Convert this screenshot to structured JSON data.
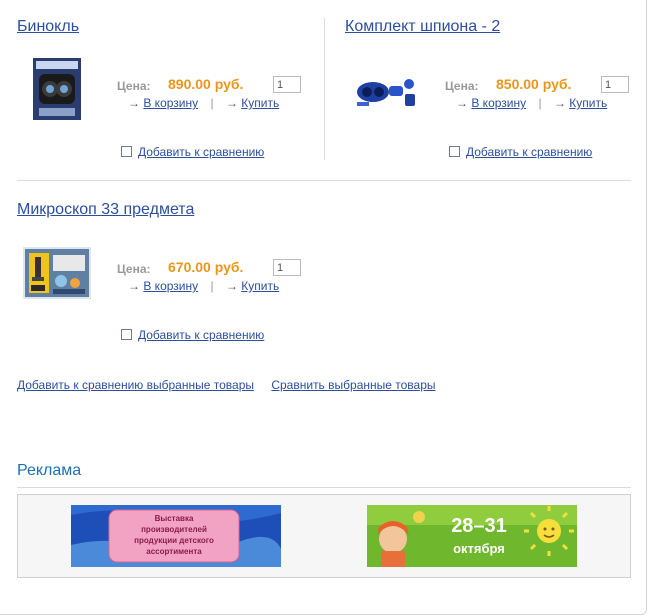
{
  "products": [
    {
      "title": "Бинокль",
      "price_label": "Цена:",
      "price": "890.00 руб.",
      "qty": "1",
      "cart": "В корзину",
      "buy": "Купить",
      "compare": "Добавить к сравнению"
    },
    {
      "title": "Комплект шпиона - 2",
      "price_label": "Цена:",
      "price": "850.00 руб.",
      "qty": "1",
      "cart": "В корзину",
      "buy": "Купить",
      "compare": "Добавить к сравнению"
    },
    {
      "title": "Микроскоп 33 предмета",
      "price_label": "Цена:",
      "price": "670.00 руб.",
      "qty": "1",
      "cart": "В корзину",
      "buy": "Купить",
      "compare": "Добавить к сравнению"
    }
  ],
  "actions": {
    "arrow": "→",
    "separator": "|"
  },
  "bottom_links": {
    "add_selected": "Добавить к сравнению выбранные товары",
    "compare_selected": "Сравнить выбранные товары"
  },
  "ads": {
    "title": "Реклама",
    "banner1": {
      "line1": "Выставка",
      "line2": "производителей",
      "line3": "продукции детского",
      "line4": "ассортимента"
    },
    "banner2": {
      "dates": "28–31",
      "month": "октября"
    }
  },
  "colors": {
    "link": "#2b4f9e",
    "price": "#e8961d",
    "ad_title": "#1e6fb0"
  }
}
